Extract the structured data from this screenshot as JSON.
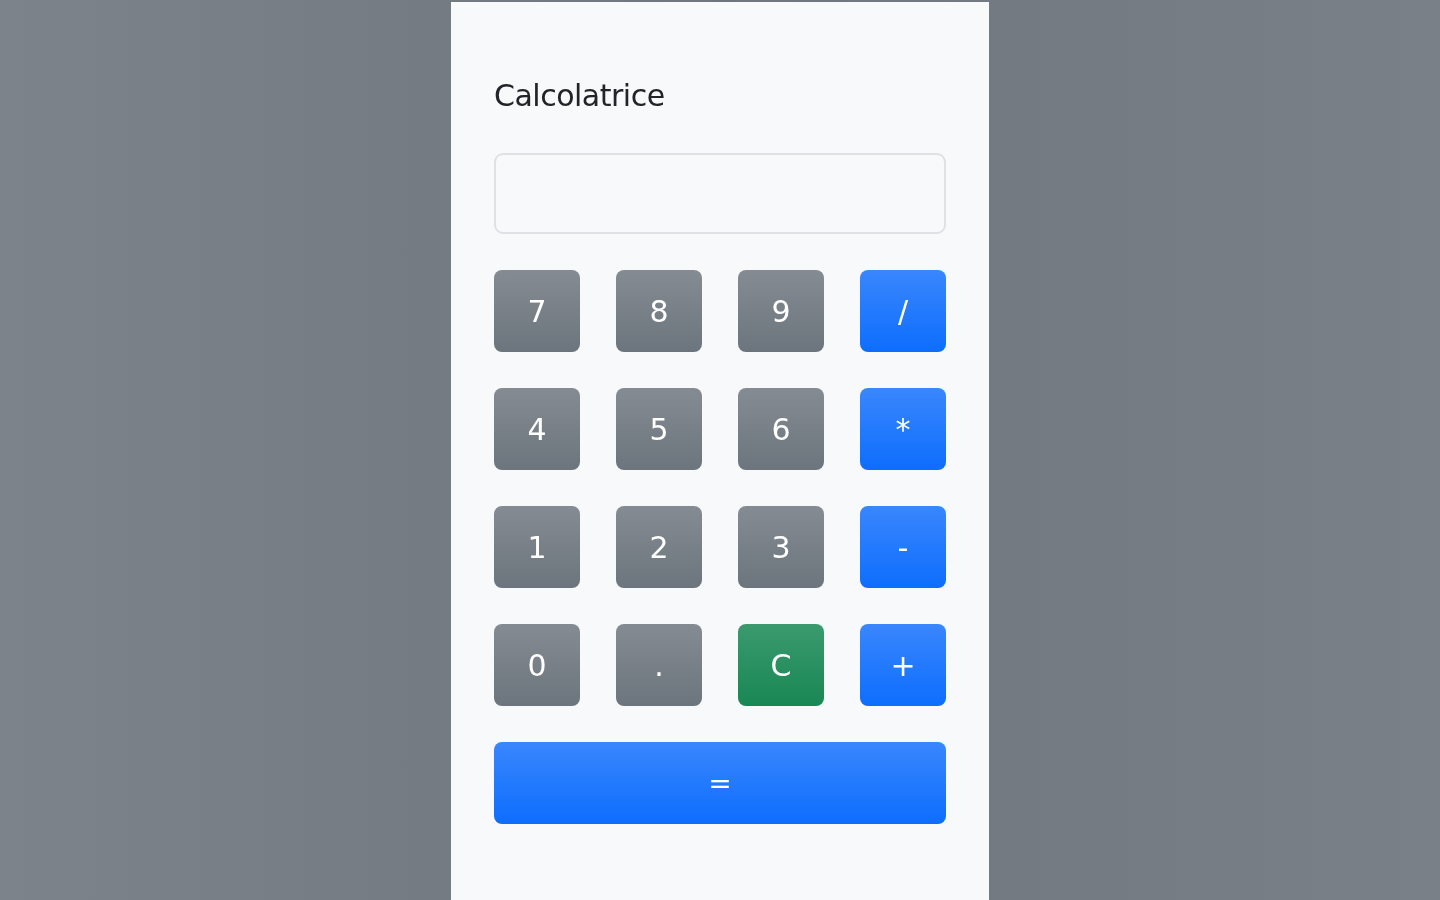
{
  "title": "Calcolatrice",
  "keys": [
    {
      "label": "7",
      "kind": "digit"
    },
    {
      "label": "8",
      "kind": "digit"
    },
    {
      "label": "9",
      "kind": "digit"
    },
    {
      "label": "/",
      "kind": "operator"
    },
    {
      "label": "4",
      "kind": "digit"
    },
    {
      "label": "5",
      "kind": "digit"
    },
    {
      "label": "6",
      "kind": "digit"
    },
    {
      "label": "*",
      "kind": "operator"
    },
    {
      "label": "1",
      "kind": "digit"
    },
    {
      "label": "2",
      "kind": "digit"
    },
    {
      "label": "3",
      "kind": "digit"
    },
    {
      "label": "-",
      "kind": "operator"
    },
    {
      "label": "0",
      "kind": "digit"
    },
    {
      "label": ".",
      "kind": "digit"
    },
    {
      "label": "C",
      "kind": "clear"
    },
    {
      "label": "+",
      "kind": "operator"
    }
  ],
  "equals": {
    "label": "="
  }
}
